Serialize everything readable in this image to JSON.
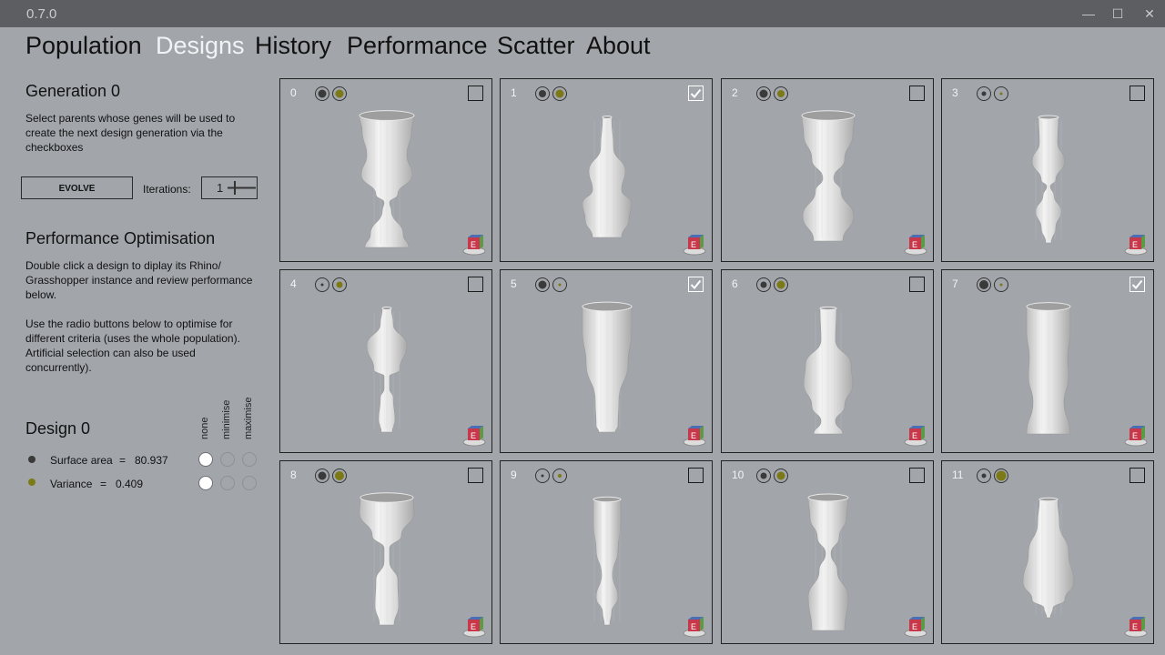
{
  "app": {
    "version": "0.7.0"
  },
  "window_controls": {
    "minimize": "—",
    "maximize": "☐",
    "close": "✕"
  },
  "nav": [
    "Population",
    "Designs",
    "History",
    "Performance",
    "Scatter",
    "About"
  ],
  "active_tab": "Designs",
  "left_panel": {
    "generation_title": "Generation 0",
    "generation_desc_lines": [
      "Select parents whose genes will be used to",
      "create the next design generation via the",
      "checkboxes"
    ],
    "evolve_label": "EVOLVE",
    "iterations_label": "Iterations:",
    "iterations_value": "1",
    "perf_title": "Performance Optimisation",
    "perf_desc_lines": [
      "Double click a design to diplay its Rhino/",
      "Grasshopper instance and review performance",
      "below.",
      "",
      "Use the radio buttons below to optimise for",
      "different criteria (uses the whole population).",
      "Artificial selection can also be used",
      "concurrently)."
    ],
    "design_title": "Design 0",
    "col_none": "none",
    "col_min": "minimise",
    "col_max": "maximise",
    "criteria": [
      {
        "name": "Surface area",
        "eq": "=",
        "value": "80.937",
        "color": "#3a3a3a",
        "selected": "none"
      },
      {
        "name": "Variance",
        "eq": "=",
        "value": "0.409",
        "color": "#7b7a16",
        "selected": "none"
      }
    ]
  },
  "designs": [
    {
      "id": "0",
      "checked": false,
      "sa": 0.75,
      "var": 0.75
    },
    {
      "id": "1",
      "checked": true,
      "sa": 0.7,
      "var": 0.75
    },
    {
      "id": "2",
      "checked": false,
      "sa": 0.75,
      "var": 0.7
    },
    {
      "id": "3",
      "checked": false,
      "sa": 0.45,
      "var": 0.18
    },
    {
      "id": "4",
      "checked": false,
      "sa": 0.18,
      "var": 0.55
    },
    {
      "id": "5",
      "checked": true,
      "sa": 0.75,
      "var": 0.2
    },
    {
      "id": "6",
      "checked": false,
      "sa": 0.6,
      "var": 0.75
    },
    {
      "id": "7",
      "checked": true,
      "sa": 0.85,
      "var": 0.12
    },
    {
      "id": "8",
      "checked": false,
      "sa": 0.75,
      "var": 0.85
    },
    {
      "id": "9",
      "checked": false,
      "sa": 0.2,
      "var": 0.35
    },
    {
      "id": "10",
      "checked": false,
      "sa": 0.6,
      "var": 0.75
    },
    {
      "id": "11",
      "checked": false,
      "sa": 0.45,
      "var": 0.95
    }
  ],
  "colors": {
    "background": "#a2a6ab",
    "titlebar": "#5c5e61",
    "indicator_dark": "#3a3a3a",
    "indicator_olive": "#7b7a16"
  },
  "icons": {
    "design_badge": "rhino-grasshopper-icon"
  }
}
